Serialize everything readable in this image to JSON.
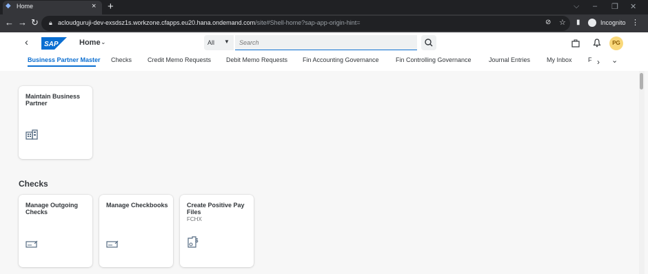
{
  "browser": {
    "tab_title": "Home",
    "tab_close": "×",
    "new_tab": "+",
    "url_host": "acloudguruji-dev-exsdsz1s.workzone.cfapps.eu20.hana.ondemand.com",
    "url_path": "/site#Shell-home?sap-app-origin-hint=",
    "profile_label": "Incognito",
    "nav": {
      "back": "←",
      "forward": "→",
      "reload": "↻"
    },
    "window_controls": {
      "tab_search": "⌵",
      "minimize": "–",
      "restore": "❐",
      "close": "✕"
    },
    "toolbar_icons": {
      "eye_off": "⊘",
      "star": "☆",
      "side_panel": "▮",
      "menu": "⋮"
    }
  },
  "shell": {
    "back": "‹",
    "logo_text": "SAP",
    "home_label": "Home",
    "home_chevron": "⌄",
    "search_scope": "All",
    "search_placeholder": "Search",
    "avatar_initials": "PG",
    "icons": {
      "search": "🔍",
      "briefcase": "⊡",
      "bell": "🔔"
    }
  },
  "nav_tabs": [
    "Business Partner Master",
    "Checks",
    "Credit Memo Requests",
    "Debit Memo Requests",
    "Fin Accounting Governance",
    "Fin Controlling Governance",
    "Journal Entries",
    "My Inbox",
    "F"
  ],
  "nav_overflow": {
    "next": "›",
    "more": "⌄"
  },
  "sections": {
    "checks_title": "Checks"
  },
  "tiles": {
    "maintain_bp": {
      "title": "Maintain Business Partner"
    },
    "manage_outgoing_checks": {
      "title": "Manage Outgoing Checks"
    },
    "manage_checkbooks": {
      "title": "Manage Checkbooks"
    },
    "create_positive_pay": {
      "title": "Create Positive Pay Files",
      "subtitle": "FCHX"
    }
  },
  "colors": {
    "accent": "#0a6ed1",
    "sap_logo": "#0a6ed1",
    "avatar_bg": "#f9d87a"
  }
}
